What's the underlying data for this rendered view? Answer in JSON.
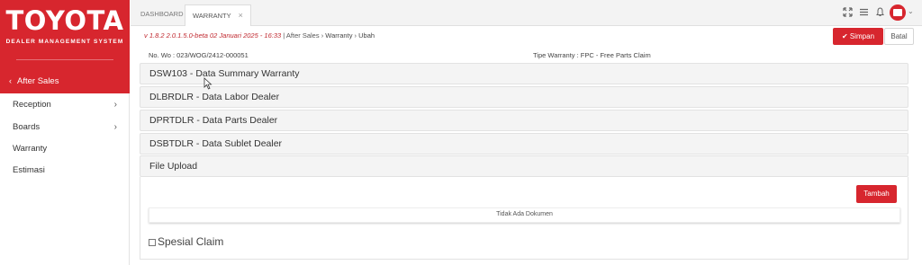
{
  "brand": {
    "logo": "TOYOTA",
    "subtitle": "DEALER MANAGEMENT SYSTEM",
    "color": "#d7262e"
  },
  "sidebar": {
    "active": "After Sales",
    "items": [
      {
        "label": "Reception",
        "has_children": true
      },
      {
        "label": "Boards",
        "has_children": true
      },
      {
        "label": "Warranty",
        "has_children": false
      },
      {
        "label": "Estimasi",
        "has_children": false
      }
    ]
  },
  "tabs": [
    {
      "label": "DASHBOARD",
      "active": false
    },
    {
      "label": "WARRANTY",
      "active": true,
      "close": "×"
    }
  ],
  "topbar_icons": [
    "fullscreen-icon",
    "menu-icon",
    "bell-icon",
    "user-avatar"
  ],
  "breadcrumb": {
    "version": "v 1.8.2 2.0.1.5.0-beta 02 Januari 2025 - 16:33",
    "separator": "|",
    "trail": [
      "After Sales",
      "Warranty",
      "Ubah"
    ]
  },
  "actions": {
    "save": "Simpan",
    "cancel": "Batal"
  },
  "header": {
    "wo_no": "No. Wo : 023/WOG/2412-000051",
    "warranty_type": "Tipe Warranty : FPC - Free Parts Claim"
  },
  "panels": [
    "DSW103 - Data Summary Warranty",
    "DLBRDLR - Data Labor Dealer",
    "DPRTDLR - Data Parts Dealer",
    "DSBTDLR - Data Sublet Dealer",
    "File Upload"
  ],
  "file_upload": {
    "add_button": "Tambah",
    "empty_text": "Tidak Ada Dokumen"
  },
  "special_claim": {
    "label": "Spesial Claim",
    "checked": false
  }
}
